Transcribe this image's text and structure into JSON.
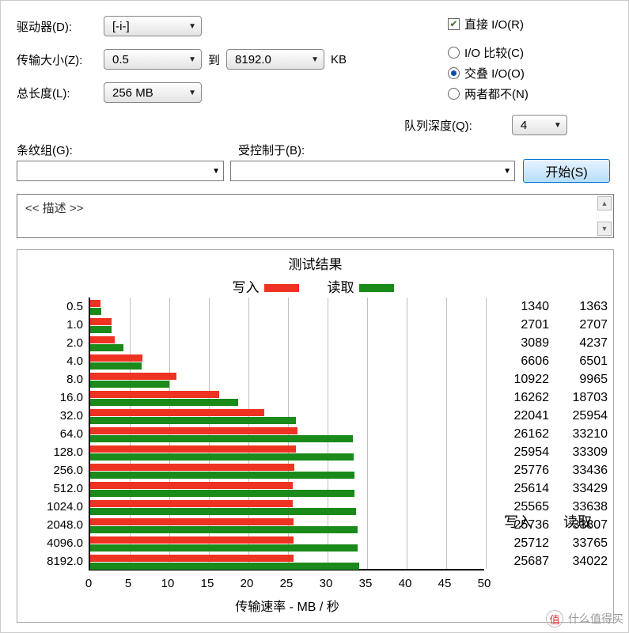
{
  "labels": {
    "drive": "驱动器(D):",
    "transfer": "传输大小(Z):",
    "to": "到",
    "kb": "KB",
    "length": "总长度(L):",
    "direct_io": "直接 I/O(R)",
    "io_compare": "I/O 比较(C)",
    "overlap_io": "交叠 I/O(O)",
    "neither": "两者都不(N)",
    "queue_depth": "队列深度(Q):",
    "stripe": "条纹组(G):",
    "bound": "受控制于(B):",
    "start": "开始(S)",
    "desc": "<< 描述 >>",
    "chart_title": "测试结果",
    "write": "写入",
    "read": "读取",
    "xaxis": "传输速率 - MB / 秒",
    "watermark": "什么值得买"
  },
  "values": {
    "drive": "[-i-]",
    "xfer_from": "0.5",
    "xfer_to": "8192.0",
    "length": "256 MB",
    "qdepth": "4"
  },
  "chart_data": {
    "type": "bar",
    "orientation": "horizontal",
    "title": "测试结果",
    "xlabel": "传输速率 - MB / 秒",
    "xlim": [
      0,
      50
    ],
    "xticks": [
      0,
      5,
      10,
      15,
      20,
      25,
      30,
      35,
      40,
      45,
      50
    ],
    "categories": [
      "0.5",
      "1.0",
      "2.0",
      "4.0",
      "8.0",
      "16.0",
      "32.0",
      "64.0",
      "128.0",
      "256.0",
      "512.0",
      "1024.0",
      "2048.0",
      "4096.0",
      "8192.0"
    ],
    "series": [
      {
        "name": "写入",
        "color": "#e32",
        "values": [
          1340,
          2701,
          3089,
          6606,
          10922,
          16262,
          22041,
          26162,
          25954,
          25776,
          25614,
          25565,
          25736,
          25712,
          25687
        ]
      },
      {
        "name": "读取",
        "color": "#1a8a1a",
        "values": [
          1363,
          2707,
          4237,
          6501,
          9965,
          18703,
          25954,
          33210,
          33309,
          33436,
          33429,
          33638,
          33807,
          33765,
          34022
        ]
      }
    ],
    "display_scale_divisor": 1000,
    "note": "bar lengths correspond to values/1000 in MB/s units on the x-axis"
  }
}
